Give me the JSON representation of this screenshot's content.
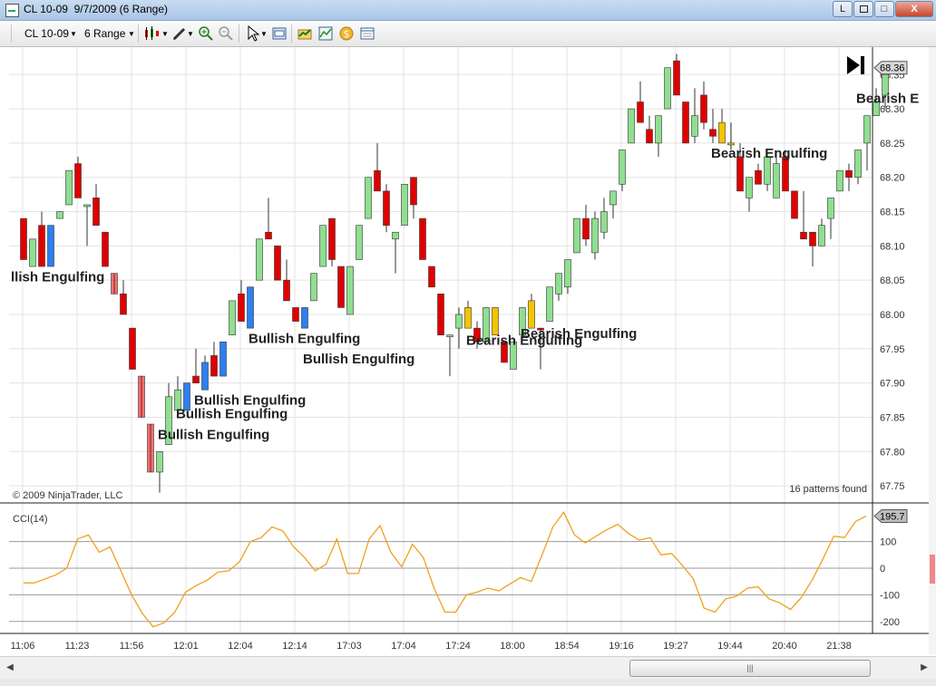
{
  "window": {
    "title": "CL 10-09  9/7/2009 (6 Range)",
    "minimize_label": "L",
    "maximize_label": "□",
    "close_label": "X"
  },
  "toolbar": {
    "instrument": "CL 10-09",
    "interval": "6 Range",
    "icons": [
      "candlestick-style-icon",
      "drawing-tool-icon",
      "zoom-in-icon",
      "zoom-out-icon",
      "pointer-icon",
      "properties-icon",
      "strategy-icon",
      "indicator-icon",
      "dollar-icon",
      "data-box-icon"
    ]
  },
  "chart_data": [
    {
      "type": "candlestick",
      "title": "CL 10-09 6 Range",
      "x_tick_labels": [
        "11:06",
        "11:23",
        "11:56",
        "12:01",
        "12:04",
        "12:14",
        "17:03",
        "17:04",
        "17:24",
        "18:00",
        "18:54",
        "19:16",
        "19:27",
        "19:44",
        "20:40",
        "21:38"
      ],
      "y_tick_labels": [
        "68.35",
        "68.30",
        "68.25",
        "68.20",
        "68.15",
        "68.10",
        "68.05",
        "68.00",
        "67.95",
        "67.90",
        "67.85",
        "67.80",
        "67.75"
      ],
      "ylim": [
        67.725,
        68.39
      ],
      "grid": true,
      "last_price": "68.36",
      "candle_colors": {
        "up": "#8fdf8f",
        "down": "#e00000",
        "pattern_up": "#2e7ff0",
        "pattern_down": "#f4c400"
      },
      "candles": [
        {
          "o": 68.14,
          "h": 68.14,
          "l": 68.08,
          "c": 68.08,
          "col": "down"
        },
        {
          "o": 68.07,
          "h": 68.11,
          "l": 68.07,
          "c": 68.11,
          "col": "up"
        },
        {
          "o": 68.13,
          "h": 68.15,
          "l": 68.07,
          "c": 68.07,
          "col": "down"
        },
        {
          "o": 68.07,
          "h": 68.13,
          "l": 68.07,
          "c": 68.13,
          "col": "pattern_up"
        },
        {
          "o": 68.14,
          "h": 68.15,
          "l": 68.14,
          "c": 68.15,
          "col": "up"
        },
        {
          "o": 68.16,
          "h": 68.21,
          "l": 68.16,
          "c": 68.21,
          "col": "up"
        },
        {
          "o": 68.22,
          "h": 68.23,
          "l": 68.17,
          "c": 68.17,
          "col": "down"
        },
        {
          "o": 68.16,
          "h": 68.16,
          "l": 68.1,
          "c": 68.16,
          "col": "up"
        },
        {
          "o": 68.17,
          "h": 68.19,
          "l": 68.13,
          "c": 68.13,
          "col": "down"
        },
        {
          "o": 68.12,
          "h": 68.12,
          "l": 68.07,
          "c": 68.07,
          "col": "down"
        },
        {
          "o": 68.06,
          "h": 68.06,
          "l": 68.03,
          "c": 68.03,
          "col": "down",
          "fade": true
        },
        {
          "o": 68.03,
          "h": 68.05,
          "l": 68.0,
          "c": 68.0,
          "col": "down"
        },
        {
          "o": 67.98,
          "h": 67.98,
          "l": 67.92,
          "c": 67.92,
          "col": "down"
        },
        {
          "o": 67.91,
          "h": 67.91,
          "l": 67.85,
          "c": 67.85,
          "col": "down",
          "fade": true
        },
        {
          "o": 67.84,
          "h": 67.84,
          "l": 67.77,
          "c": 67.77,
          "col": "down",
          "fade": true
        },
        {
          "o": 67.77,
          "h": 67.8,
          "l": 67.74,
          "c": 67.8,
          "col": "up"
        },
        {
          "o": 67.81,
          "h": 67.9,
          "l": 67.81,
          "c": 67.88,
          "col": "up"
        },
        {
          "o": 67.86,
          "h": 67.91,
          "l": 67.86,
          "c": 67.89,
          "col": "up"
        },
        {
          "o": 67.86,
          "h": 67.9,
          "l": 67.86,
          "c": 67.9,
          "col": "pattern_up"
        },
        {
          "o": 67.91,
          "h": 67.95,
          "l": 67.9,
          "c": 67.9,
          "col": "down"
        },
        {
          "o": 67.89,
          "h": 67.94,
          "l": 67.89,
          "c": 67.93,
          "col": "pattern_up"
        },
        {
          "o": 67.94,
          "h": 67.96,
          "l": 67.91,
          "c": 67.91,
          "col": "down"
        },
        {
          "o": 67.91,
          "h": 67.96,
          "l": 67.91,
          "c": 67.96,
          "col": "pattern_up"
        },
        {
          "o": 67.97,
          "h": 68.02,
          "l": 67.97,
          "c": 68.02,
          "col": "up"
        },
        {
          "o": 68.03,
          "h": 68.05,
          "l": 67.99,
          "c": 67.99,
          "col": "down"
        },
        {
          "o": 67.98,
          "h": 68.04,
          "l": 67.98,
          "c": 68.04,
          "col": "pattern_up"
        },
        {
          "o": 68.05,
          "h": 68.11,
          "l": 68.05,
          "c": 68.11,
          "col": "up"
        },
        {
          "o": 68.12,
          "h": 68.17,
          "l": 68.11,
          "c": 68.11,
          "col": "down"
        },
        {
          "o": 68.1,
          "h": 68.1,
          "l": 68.05,
          "c": 68.05,
          "col": "down"
        },
        {
          "o": 68.05,
          "h": 68.08,
          "l": 68.02,
          "c": 68.02,
          "col": "down"
        },
        {
          "o": 68.01,
          "h": 68.01,
          "l": 67.99,
          "c": 67.99,
          "col": "down"
        },
        {
          "o": 67.98,
          "h": 68.01,
          "l": 67.98,
          "c": 68.01,
          "col": "pattern_up"
        },
        {
          "o": 68.02,
          "h": 68.06,
          "l": 68.02,
          "c": 68.06,
          "col": "up"
        },
        {
          "o": 68.07,
          "h": 68.13,
          "l": 68.07,
          "c": 68.13,
          "col": "up"
        },
        {
          "o": 68.14,
          "h": 68.14,
          "l": 68.07,
          "c": 68.08,
          "col": "down"
        },
        {
          "o": 68.07,
          "h": 68.07,
          "l": 68.01,
          "c": 68.01,
          "col": "down"
        },
        {
          "o": 68.0,
          "h": 68.07,
          "l": 68.0,
          "c": 68.07,
          "col": "up"
        },
        {
          "o": 68.08,
          "h": 68.13,
          "l": 68.08,
          "c": 68.13,
          "col": "up"
        },
        {
          "o": 68.14,
          "h": 68.2,
          "l": 68.14,
          "c": 68.2,
          "col": "up"
        },
        {
          "o": 68.21,
          "h": 68.25,
          "l": 68.18,
          "c": 68.18,
          "col": "down"
        },
        {
          "o": 68.18,
          "h": 68.19,
          "l": 68.12,
          "c": 68.13,
          "col": "down"
        },
        {
          "o": 68.11,
          "h": 68.11,
          "l": 68.06,
          "c": 68.12,
          "col": "up"
        },
        {
          "o": 68.13,
          "h": 68.19,
          "l": 68.13,
          "c": 68.19,
          "col": "up"
        },
        {
          "o": 68.2,
          "h": 68.2,
          "l": 68.14,
          "c": 68.16,
          "col": "down"
        },
        {
          "o": 68.14,
          "h": 68.14,
          "l": 68.08,
          "c": 68.08,
          "col": "down"
        },
        {
          "o": 68.07,
          "h": 68.07,
          "l": 68.04,
          "c": 68.04,
          "col": "down"
        },
        {
          "o": 68.03,
          "h": 68.03,
          "l": 67.97,
          "c": 67.97,
          "col": "down"
        },
        {
          "o": 67.97,
          "h": 67.97,
          "l": 67.91,
          "c": 67.97,
          "col": "up"
        },
        {
          "o": 67.98,
          "h": 68.01,
          "l": 67.95,
          "c": 68.0,
          "col": "up"
        },
        {
          "o": 68.01,
          "h": 68.02,
          "l": 67.98,
          "c": 67.98,
          "col": "pattern_down"
        },
        {
          "o": 67.98,
          "h": 67.99,
          "l": 67.95,
          "c": 67.96,
          "col": "down"
        },
        {
          "o": 67.96,
          "h": 68.01,
          "l": 67.96,
          "c": 68.01,
          "col": "up"
        },
        {
          "o": 68.01,
          "h": 68.01,
          "l": 67.97,
          "c": 67.97,
          "col": "pattern_down"
        },
        {
          "o": 67.96,
          "h": 67.96,
          "l": 67.93,
          "c": 67.93,
          "col": "down"
        },
        {
          "o": 67.92,
          "h": 67.96,
          "l": 67.92,
          "c": 67.96,
          "col": "up"
        },
        {
          "o": 67.97,
          "h": 68.01,
          "l": 67.97,
          "c": 68.01,
          "col": "up"
        },
        {
          "o": 68.02,
          "h": 68.03,
          "l": 67.98,
          "c": 67.98,
          "col": "pattern_down"
        },
        {
          "o": 67.98,
          "h": 67.98,
          "l": 67.92,
          "c": 67.98,
          "col": "down"
        },
        {
          "o": 67.99,
          "h": 68.04,
          "l": 67.99,
          "c": 68.04,
          "col": "up"
        },
        {
          "o": 68.03,
          "h": 68.06,
          "l": 68.02,
          "c": 68.06,
          "col": "up"
        },
        {
          "o": 68.04,
          "h": 68.08,
          "l": 68.03,
          "c": 68.08,
          "col": "up"
        },
        {
          "o": 68.09,
          "h": 68.14,
          "l": 68.09,
          "c": 68.14,
          "col": "up"
        },
        {
          "o": 68.11,
          "h": 68.16,
          "l": 68.1,
          "c": 68.14,
          "col": "down"
        },
        {
          "o": 68.09,
          "h": 68.15,
          "l": 68.08,
          "c": 68.14,
          "col": "up"
        },
        {
          "o": 68.12,
          "h": 68.17,
          "l": 68.11,
          "c": 68.15,
          "col": "up"
        },
        {
          "o": 68.16,
          "h": 68.18,
          "l": 68.14,
          "c": 68.18,
          "col": "up"
        },
        {
          "o": 68.19,
          "h": 68.24,
          "l": 68.18,
          "c": 68.24,
          "col": "up"
        },
        {
          "o": 68.25,
          "h": 68.3,
          "l": 68.25,
          "c": 68.3,
          "col": "up"
        },
        {
          "o": 68.31,
          "h": 68.34,
          "l": 68.28,
          "c": 68.28,
          "col": "down"
        },
        {
          "o": 68.27,
          "h": 68.29,
          "l": 68.25,
          "c": 68.25,
          "col": "down"
        },
        {
          "o": 68.25,
          "h": 68.29,
          "l": 68.23,
          "c": 68.29,
          "col": "up"
        },
        {
          "o": 68.3,
          "h": 68.36,
          "l": 68.3,
          "c": 68.36,
          "col": "up"
        },
        {
          "o": 68.37,
          "h": 68.38,
          "l": 68.32,
          "c": 68.32,
          "col": "down"
        },
        {
          "o": 68.31,
          "h": 68.31,
          "l": 68.25,
          "c": 68.25,
          "col": "down"
        },
        {
          "o": 68.26,
          "h": 68.33,
          "l": 68.25,
          "c": 68.29,
          "col": "up"
        },
        {
          "o": 68.32,
          "h": 68.34,
          "l": 68.27,
          "c": 68.28,
          "col": "down"
        },
        {
          "o": 68.27,
          "h": 68.3,
          "l": 68.25,
          "c": 68.26,
          "col": "down"
        },
        {
          "o": 68.25,
          "h": 68.3,
          "l": 68.25,
          "c": 68.28,
          "col": "pattern_down"
        },
        {
          "o": 68.25,
          "h": 68.28,
          "l": 68.24,
          "c": 68.25,
          "col": "pattern_down"
        },
        {
          "o": 68.23,
          "h": 68.25,
          "l": 68.18,
          "c": 68.18,
          "col": "down"
        },
        {
          "o": 68.17,
          "h": 68.2,
          "l": 68.15,
          "c": 68.2,
          "col": "up"
        },
        {
          "o": 68.21,
          "h": 68.22,
          "l": 68.19,
          "c": 68.19,
          "col": "down"
        },
        {
          "o": 68.19,
          "h": 68.24,
          "l": 68.18,
          "c": 68.23,
          "col": "up"
        },
        {
          "o": 68.22,
          "h": 68.24,
          "l": 68.17,
          "c": 68.17,
          "col": "up"
        },
        {
          "o": 68.23,
          "h": 68.24,
          "l": 68.18,
          "c": 68.18,
          "col": "down"
        },
        {
          "o": 68.18,
          "h": 68.18,
          "l": 68.14,
          "c": 68.14,
          "col": "down"
        },
        {
          "o": 68.12,
          "h": 68.18,
          "l": 68.11,
          "c": 68.11,
          "col": "down"
        },
        {
          "o": 68.12,
          "h": 68.12,
          "l": 68.07,
          "c": 68.1,
          "col": "down"
        },
        {
          "o": 68.1,
          "h": 68.14,
          "l": 68.1,
          "c": 68.13,
          "col": "up"
        },
        {
          "o": 68.14,
          "h": 68.17,
          "l": 68.11,
          "c": 68.17,
          "col": "up"
        },
        {
          "o": 68.18,
          "h": 68.21,
          "l": 68.18,
          "c": 68.21,
          "col": "up"
        },
        {
          "o": 68.2,
          "h": 68.22,
          "l": 68.18,
          "c": 68.21,
          "col": "down"
        },
        {
          "o": 68.2,
          "h": 68.24,
          "l": 68.19,
          "c": 68.24,
          "col": "up"
        },
        {
          "o": 68.25,
          "h": 68.29,
          "l": 68.21,
          "c": 68.29,
          "col": "up"
        },
        {
          "o": 68.29,
          "h": 68.33,
          "l": 68.29,
          "c": 68.31,
          "col": "up"
        },
        {
          "o": 68.32,
          "h": 68.35,
          "l": 68.3,
          "c": 68.35,
          "col": "up"
        }
      ],
      "annotations": [
        {
          "text": "llish Engulfing",
          "i": 10,
          "y": 68.055
        },
        {
          "text": "Bullish Engulfing",
          "i": 26,
          "y": 67.965
        },
        {
          "text": "Bullish Engulfing",
          "i": 32,
          "y": 67.935
        },
        {
          "text": "Bullish Engulfing",
          "i": 20,
          "y": 67.875
        },
        {
          "text": "Bullish Engulfing",
          "i": 18,
          "y": 67.855
        },
        {
          "text": "Bullish Engulfing",
          "i": 16,
          "y": 67.825
        },
        {
          "text": "Bearish Engulfing",
          "i": 50,
          "y": 67.962
        },
        {
          "text": "Bearish Engulfing",
          "i": 56,
          "y": 67.972
        },
        {
          "text": "Bearish Engulfing",
          "i": 77,
          "y": 68.235
        },
        {
          "text": "Bearish E",
          "i": 93,
          "y": 68.315
        }
      ],
      "copyright": "© 2009 NinjaTrader, LLC",
      "patterns_found": "16 patterns found"
    },
    {
      "type": "line",
      "title": "CCI(14)",
      "y_tick_labels": [
        "100",
        "0",
        "-100",
        "-200"
      ],
      "ylim": [
        -245,
        245
      ],
      "last_value": "195.7",
      "color": "#f0a020",
      "values": [
        -55,
        -55,
        -40,
        -25,
        0,
        110,
        125,
        60,
        80,
        -10,
        -100,
        -170,
        -220,
        -205,
        -165,
        -90,
        -65,
        -45,
        -15,
        -10,
        25,
        100,
        115,
        155,
        140,
        80,
        40,
        -10,
        15,
        110,
        -20,
        -20,
        110,
        160,
        60,
        5,
        90,
        40,
        -75,
        -165,
        -165,
        -100,
        -90,
        -75,
        -85,
        -60,
        -35,
        -50,
        50,
        155,
        210,
        125,
        95,
        120,
        145,
        165,
        130,
        105,
        115,
        50,
        55,
        10,
        -40,
        -150,
        -165,
        -115,
        -105,
        -75,
        -70,
        -115,
        -130,
        -155,
        -110,
        -45,
        35,
        120,
        115,
        175,
        196
      ]
    }
  ]
}
